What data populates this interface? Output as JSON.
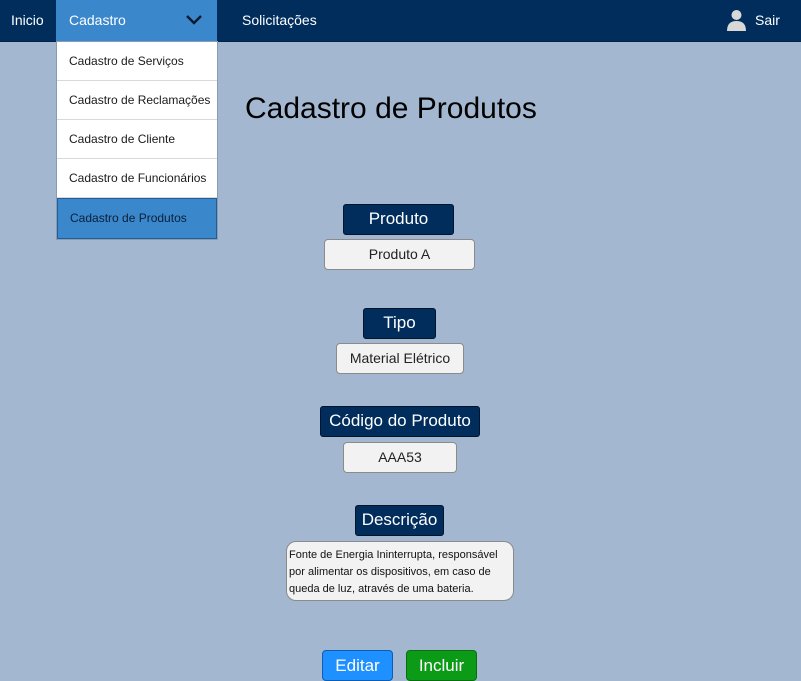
{
  "nav": {
    "inicio": "Inicio",
    "cadastro": "Cadastro",
    "solicitacoes": "Solicitações",
    "sair": "Sair"
  },
  "dropdown": {
    "items": [
      {
        "label": "Cadastro de Serviços"
      },
      {
        "label": "Cadastro de Reclamações"
      },
      {
        "label": "Cadastro de Cliente"
      },
      {
        "label": "Cadastro de Funcionários"
      },
      {
        "label": "Cadastro de Produtos"
      }
    ],
    "active_index": 4
  },
  "page": {
    "title": "Cadastro de Produtos"
  },
  "form": {
    "produto": {
      "label": "Produto",
      "value": "Produto A"
    },
    "tipo": {
      "label": "Tipo",
      "value": "Material Elétrico"
    },
    "codigo": {
      "label": "Código do Produto",
      "value": "AAA53"
    },
    "descricao": {
      "label": "Descrição",
      "value": "Fonte de Energia Ininterrupta, responsável por alimentar os dispositivos, em caso de queda de luz, através de uma bateria."
    }
  },
  "buttons": {
    "editar": "Editar",
    "incluir": "Incluir"
  },
  "colors": {
    "navbar": "#002d5c",
    "active": "#3a87cc",
    "background": "#a3b8d0",
    "editar": "#1e90ff",
    "incluir": "#0c9b16"
  },
  "icons": {
    "chevron": "chevron-down-icon",
    "user": "user-icon"
  }
}
